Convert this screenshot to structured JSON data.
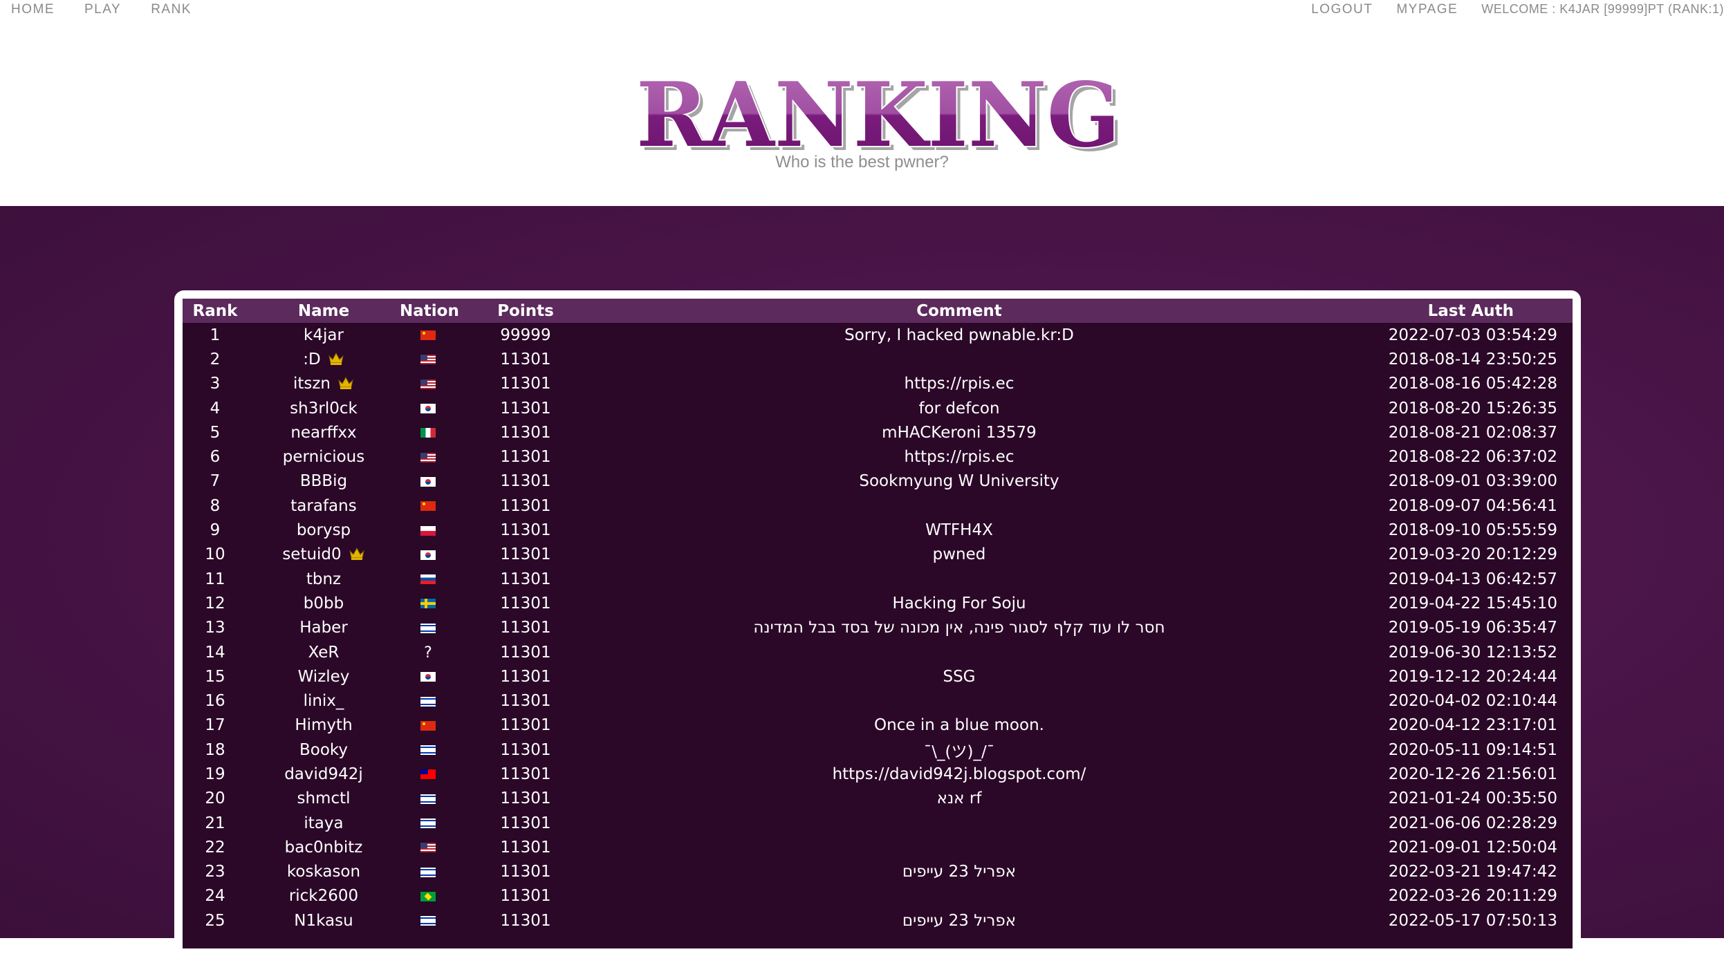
{
  "nav": {
    "left": [
      "HOME",
      "PLAY",
      "RANK"
    ],
    "logout": "LOGOUT",
    "mypage": "MYPAGE",
    "welcome": "WELCOME : K4JAR [99999]PT (RANK:1)"
  },
  "header": {
    "logo_text": "RANKING",
    "subtitle": "Who is the best pwner?"
  },
  "table": {
    "columns": [
      "Rank",
      "Name",
      "Nation",
      "Points",
      "Comment",
      "Last Auth"
    ],
    "rows": [
      {
        "rank": "1",
        "name": "k4jar",
        "crown": false,
        "nation": "cn",
        "points": "99999",
        "comment": "Sorry, I hacked pwnable.kr:D",
        "auth": "2022-07-03 03:54:29"
      },
      {
        "rank": "2",
        "name": ":D",
        "crown": true,
        "nation": "us",
        "points": "11301",
        "comment": "",
        "auth": "2018-08-14 23:50:25"
      },
      {
        "rank": "3",
        "name": "itszn",
        "crown": true,
        "nation": "us",
        "points": "11301",
        "comment": "https://rpis.ec",
        "auth": "2018-08-16 05:42:28"
      },
      {
        "rank": "4",
        "name": "sh3rl0ck",
        "crown": false,
        "nation": "kr",
        "points": "11301",
        "comment": "for defcon",
        "auth": "2018-08-20 15:26:35"
      },
      {
        "rank": "5",
        "name": "nearffxx",
        "crown": false,
        "nation": "it",
        "points": "11301",
        "comment": "mHACKeroni 13579",
        "auth": "2018-08-21 02:08:37"
      },
      {
        "rank": "6",
        "name": "pernicious",
        "crown": false,
        "nation": "us",
        "points": "11301",
        "comment": "https://rpis.ec",
        "auth": "2018-08-22 06:37:02"
      },
      {
        "rank": "7",
        "name": "BBBig",
        "crown": false,
        "nation": "kr",
        "points": "11301",
        "comment": "Sookmyung W University",
        "auth": "2018-09-01 03:39:00"
      },
      {
        "rank": "8",
        "name": "tarafans",
        "crown": false,
        "nation": "cn",
        "points": "11301",
        "comment": "",
        "auth": "2018-09-07 04:56:41"
      },
      {
        "rank": "9",
        "name": "borysp",
        "crown": false,
        "nation": "pl",
        "points": "11301",
        "comment": "WTFH4X",
        "auth": "2018-09-10 05:55:59"
      },
      {
        "rank": "10",
        "name": "setuid0",
        "crown": true,
        "nation": "kr",
        "points": "11301",
        "comment": "pwned",
        "auth": "2019-03-20 20:12:29"
      },
      {
        "rank": "11",
        "name": "tbnz",
        "crown": false,
        "nation": "sk",
        "points": "11301",
        "comment": "",
        "auth": "2019-04-13 06:42:57"
      },
      {
        "rank": "12",
        "name": "b0bb",
        "crown": false,
        "nation": "se",
        "points": "11301",
        "comment": "Hacking For Soju",
        "auth": "2019-04-22 15:45:10"
      },
      {
        "rank": "13",
        "name": "Haber",
        "crown": false,
        "nation": "il",
        "points": "11301",
        "comment": "חסר לו עוד קלף לסגור פינה, אין מכונה של בסד בבל המדינה",
        "auth": "2019-05-19 06:35:47"
      },
      {
        "rank": "14",
        "name": "XeR",
        "crown": false,
        "nation": "unk",
        "points": "11301",
        "comment": "",
        "auth": "2019-06-30 12:13:52"
      },
      {
        "rank": "15",
        "name": "Wizley",
        "crown": false,
        "nation": "kr",
        "points": "11301",
        "comment": "SSG",
        "auth": "2019-12-12 20:24:44"
      },
      {
        "rank": "16",
        "name": "linix_",
        "crown": false,
        "nation": "il",
        "points": "11301",
        "comment": "",
        "auth": "2020-04-02 02:10:44"
      },
      {
        "rank": "17",
        "name": "Himyth",
        "crown": false,
        "nation": "cn",
        "points": "11301",
        "comment": "Once in a blue moon.",
        "auth": "2020-04-12 23:17:01"
      },
      {
        "rank": "18",
        "name": "Booky",
        "crown": false,
        "nation": "il",
        "points": "11301",
        "comment": "¯\\_(ツ)_/¯",
        "auth": "2020-05-11 09:14:51"
      },
      {
        "rank": "19",
        "name": "david942j",
        "crown": false,
        "nation": "tw",
        "points": "11301",
        "comment": "https://david942j.blogspot.com/",
        "auth": "2020-12-26 21:56:01"
      },
      {
        "rank": "20",
        "name": "shmctl",
        "crown": false,
        "nation": "il",
        "points": "11301",
        "comment": "אנא rf",
        "auth": "2021-01-24 00:35:50"
      },
      {
        "rank": "21",
        "name": "itaya",
        "crown": false,
        "nation": "il",
        "points": "11301",
        "comment": "",
        "auth": "2021-06-06 02:28:29"
      },
      {
        "rank": "22",
        "name": "bac0nbitz",
        "crown": false,
        "nation": "us",
        "points": "11301",
        "comment": "",
        "auth": "2021-09-01 12:50:04"
      },
      {
        "rank": "23",
        "name": "koskason",
        "crown": false,
        "nation": "il",
        "points": "11301",
        "comment": "אפריל 23 עייפים",
        "auth": "2022-03-21 19:47:42"
      },
      {
        "rank": "24",
        "name": "rick2600",
        "crown": false,
        "nation": "br",
        "points": "11301",
        "comment": "",
        "auth": "2022-03-26 20:11:29"
      },
      {
        "rank": "25",
        "name": "N1kasu",
        "crown": false,
        "nation": "il",
        "points": "11301",
        "comment": "אפריל 23 עייפים",
        "auth": "2022-05-17 07:50:13"
      }
    ],
    "unknown_flag_text": "?"
  },
  "colors": {
    "logo_fill": "#8a2f8a",
    "header_row": "#5c2a5c",
    "table_bg": "#2b0828",
    "crown": "#e3b400"
  }
}
